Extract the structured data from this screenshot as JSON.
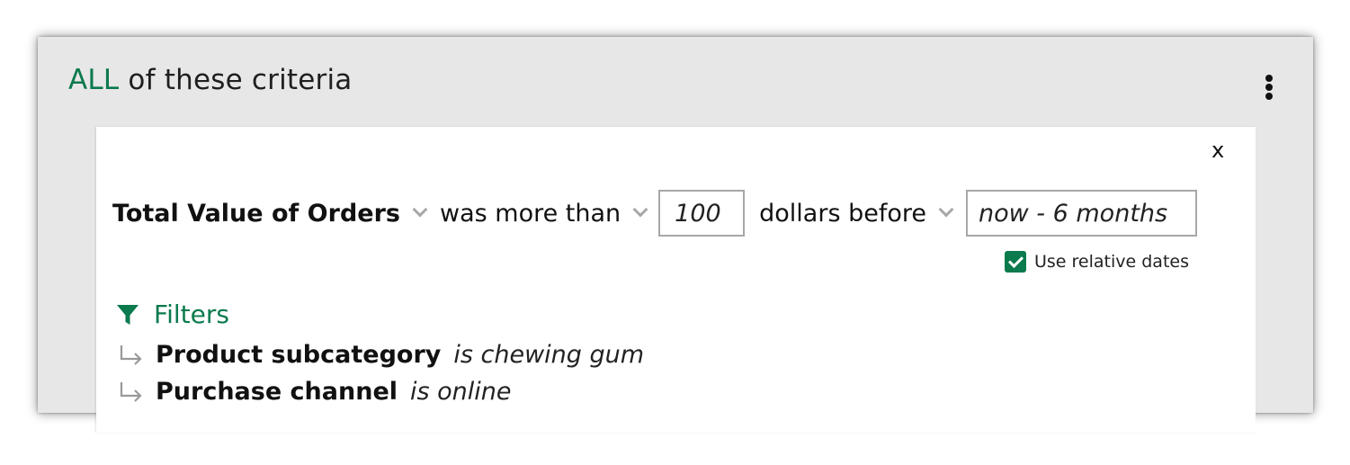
{
  "criteria": {
    "quantifier": "ALL",
    "heading_rest": "of these criteria",
    "accent_color": "#0b7a4d",
    "menu_icon": "kebab-menu-icon"
  },
  "condition": {
    "close_label": "x",
    "field": "Total Value of Orders",
    "operator": "was more than",
    "amount": "100",
    "unit_relation": "dollars before",
    "date_value": "now - 6 months",
    "use_relative_dates": {
      "checked": true,
      "label": "Use relative dates"
    }
  },
  "filters": {
    "title": "Filters",
    "icon": "funnel-icon",
    "items": [
      {
        "field": "Product subcategory",
        "condition": "is chewing gum"
      },
      {
        "field": "Purchase channel",
        "condition": "is online"
      }
    ]
  }
}
